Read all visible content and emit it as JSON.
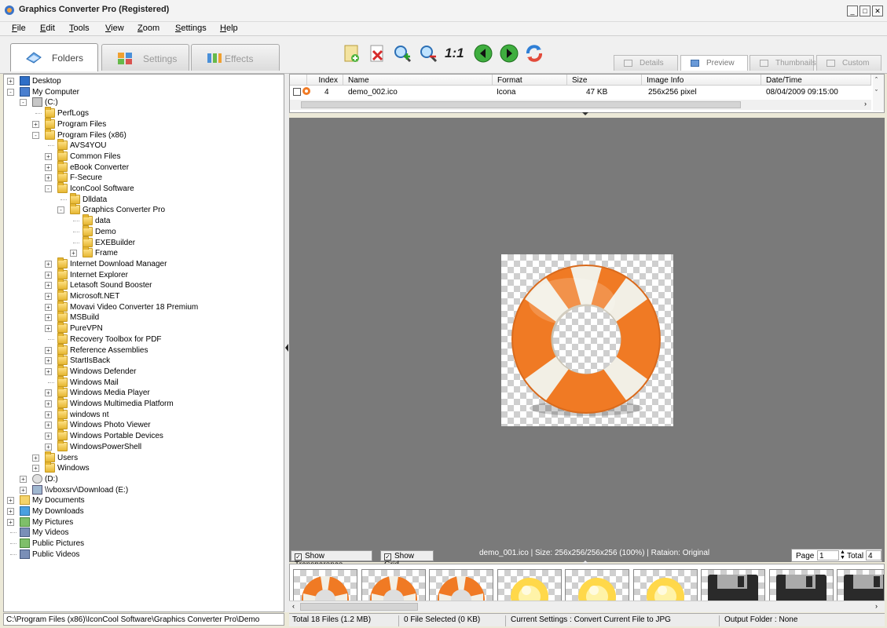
{
  "window": {
    "title": "Graphics Converter Pro  (Registered)",
    "min": "_",
    "max": "□",
    "close": "✕"
  },
  "menu": [
    "File",
    "Edit",
    "Tools",
    "View",
    "Zoom",
    "Settings",
    "Help"
  ],
  "main_tabs": {
    "folders": "Folders",
    "settings": "Settings",
    "effects": "Effects"
  },
  "toolbar_icons": [
    "new-file-icon",
    "delete-icon",
    "zoom-in-icon",
    "zoom-out-icon",
    "actual-size-icon",
    "previous-icon",
    "next-icon",
    "refresh-icon"
  ],
  "toolbar_one_to_one": "1:1",
  "view_tabs": [
    "Details",
    "Preview",
    "Thumbnails",
    "Custom"
  ],
  "tree": [
    {
      "label": "Desktop",
      "level": 0,
      "exp": "+",
      "icon": "desktop"
    },
    {
      "label": "My Computer",
      "level": 0,
      "exp": "-",
      "icon": "computer"
    },
    {
      "label": "(C:)",
      "level": 1,
      "exp": "-",
      "icon": "drive"
    },
    {
      "label": "PerfLogs",
      "level": 2,
      "exp": "",
      "icon": "folder"
    },
    {
      "label": "Program Files",
      "level": 2,
      "exp": "+",
      "icon": "folder"
    },
    {
      "label": "Program Files (x86)",
      "level": 2,
      "exp": "-",
      "icon": "folder"
    },
    {
      "label": "AVS4YOU",
      "level": 3,
      "exp": "",
      "icon": "folder"
    },
    {
      "label": "Common Files",
      "level": 3,
      "exp": "+",
      "icon": "folder"
    },
    {
      "label": "eBook Converter",
      "level": 3,
      "exp": "+",
      "icon": "folder"
    },
    {
      "label": "F-Secure",
      "level": 3,
      "exp": "+",
      "icon": "folder"
    },
    {
      "label": "IconCool Software",
      "level": 3,
      "exp": "-",
      "icon": "folder"
    },
    {
      "label": "Dlldata",
      "level": 4,
      "exp": "",
      "icon": "folder"
    },
    {
      "label": "Graphics Converter Pro",
      "level": 4,
      "exp": "-",
      "icon": "folder"
    },
    {
      "label": "data",
      "level": 5,
      "exp": "",
      "icon": "folder"
    },
    {
      "label": "Demo",
      "level": 5,
      "exp": "",
      "icon": "folder"
    },
    {
      "label": "EXEBuilder",
      "level": 5,
      "exp": "",
      "icon": "folder"
    },
    {
      "label": "Frame",
      "level": 5,
      "exp": "+",
      "icon": "folder"
    },
    {
      "label": "Internet Download Manager",
      "level": 3,
      "exp": "+",
      "icon": "folder"
    },
    {
      "label": "Internet Explorer",
      "level": 3,
      "exp": "+",
      "icon": "folder"
    },
    {
      "label": "Letasoft Sound Booster",
      "level": 3,
      "exp": "+",
      "icon": "folder"
    },
    {
      "label": "Microsoft.NET",
      "level": 3,
      "exp": "+",
      "icon": "folder"
    },
    {
      "label": "Movavi Video Converter 18 Premium",
      "level": 3,
      "exp": "+",
      "icon": "folder"
    },
    {
      "label": "MSBuild",
      "level": 3,
      "exp": "+",
      "icon": "folder"
    },
    {
      "label": "PureVPN",
      "level": 3,
      "exp": "+",
      "icon": "folder"
    },
    {
      "label": "Recovery Toolbox for PDF",
      "level": 3,
      "exp": "",
      "icon": "folder"
    },
    {
      "label": "Reference Assemblies",
      "level": 3,
      "exp": "+",
      "icon": "folder"
    },
    {
      "label": "StartIsBack",
      "level": 3,
      "exp": "+",
      "icon": "folder"
    },
    {
      "label": "Windows Defender",
      "level": 3,
      "exp": "+",
      "icon": "folder"
    },
    {
      "label": "Windows Mail",
      "level": 3,
      "exp": "",
      "icon": "folder"
    },
    {
      "label": "Windows Media Player",
      "level": 3,
      "exp": "+",
      "icon": "folder"
    },
    {
      "label": "Windows Multimedia Platform",
      "level": 3,
      "exp": "+",
      "icon": "folder"
    },
    {
      "label": "windows nt",
      "level": 3,
      "exp": "+",
      "icon": "folder"
    },
    {
      "label": "Windows Photo Viewer",
      "level": 3,
      "exp": "+",
      "icon": "folder"
    },
    {
      "label": "Windows Portable Devices",
      "level": 3,
      "exp": "+",
      "icon": "folder"
    },
    {
      "label": "WindowsPowerShell",
      "level": 3,
      "exp": "+",
      "icon": "folder"
    },
    {
      "label": "Users",
      "level": 2,
      "exp": "+",
      "icon": "folder"
    },
    {
      "label": "Windows",
      "level": 2,
      "exp": "+",
      "icon": "folder"
    },
    {
      "label": "(D:)",
      "level": 1,
      "exp": "+",
      "icon": "cdrom"
    },
    {
      "label": "\\\\vboxsrv\\Download (E:)",
      "level": 1,
      "exp": "+",
      "icon": "netdrive"
    },
    {
      "label": "My Documents",
      "level": 0,
      "exp": "+",
      "icon": "mydocs"
    },
    {
      "label": "My Downloads",
      "level": 0,
      "exp": "+",
      "icon": "downloads"
    },
    {
      "label": "My Pictures",
      "level": 0,
      "exp": "+",
      "icon": "pictures"
    },
    {
      "label": "My Videos",
      "level": 0,
      "exp": "",
      "icon": "videos"
    },
    {
      "label": "Public Pictures",
      "level": 0,
      "exp": "",
      "icon": "pictures"
    },
    {
      "label": "Public Videos",
      "level": 0,
      "exp": "",
      "icon": "videos"
    }
  ],
  "path": "C:\\Program Files (x86)\\IconCool Software\\Graphics Converter Pro\\Demo",
  "file_list": {
    "columns": [
      "Index",
      "Name",
      "Format",
      "Size",
      "Image Info",
      "Date/Time"
    ],
    "rows": [
      {
        "index": "4",
        "name": "demo_002.ico",
        "format": "Icona",
        "size": "47 KB",
        "info": "256x256 pixel",
        "date": "08/04/2009 09:15:00"
      }
    ]
  },
  "preview": {
    "show_transparence": "Show Transparence",
    "show_grid": "Show Grid",
    "info": "demo_001.ico  |  Size: 256x256/256x256 (100%)  |  Rataion: Original",
    "page_label": "Page",
    "page_value": "1",
    "total_label": "Total",
    "total_value": "4"
  },
  "thumbnails": [
    "lifebuoy",
    "lifebuoy",
    "lifebuoy",
    "bulb",
    "bulb",
    "bulb",
    "floppy",
    "floppy",
    "floppy"
  ],
  "status": {
    "total": "Total 18 Files (1.2 MB)",
    "selected": "0 File Selected (0 KB)",
    "settings": "Current Settings : Convert Current File to JPG",
    "output": "Output Folder : None"
  },
  "colors": {
    "preview_bg": "#7a7a7a",
    "lifebuoy_orange": "#f07a24",
    "lifebuoy_white": "#f4f2ea"
  }
}
